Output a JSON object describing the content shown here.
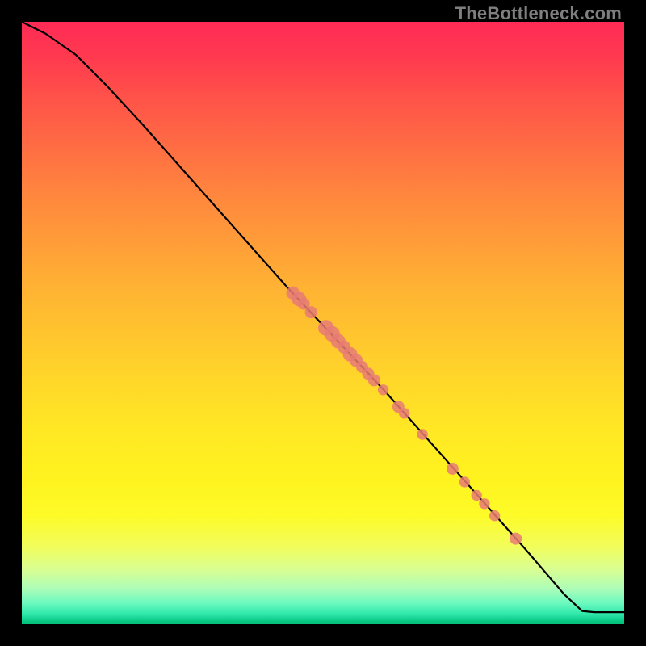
{
  "watermark": "TheBottleneck.com",
  "chart_data": {
    "type": "line",
    "title": "",
    "xlabel": "",
    "ylabel": "",
    "xlim": [
      0,
      100
    ],
    "ylim": [
      0,
      100
    ],
    "grid": false,
    "series": [
      {
        "name": "curve",
        "points": [
          {
            "x": 0,
            "y": 100
          },
          {
            "x": 4,
            "y": 98
          },
          {
            "x": 9,
            "y": 94.5
          },
          {
            "x": 14,
            "y": 89.5
          },
          {
            "x": 20,
            "y": 83
          },
          {
            "x": 28,
            "y": 74
          },
          {
            "x": 36,
            "y": 65
          },
          {
            "x": 44,
            "y": 56
          },
          {
            "x": 52,
            "y": 47.5
          },
          {
            "x": 60,
            "y": 39
          },
          {
            "x": 68,
            "y": 30
          },
          {
            "x": 76,
            "y": 21
          },
          {
            "x": 84,
            "y": 12
          },
          {
            "x": 90,
            "y": 5
          },
          {
            "x": 93,
            "y": 2.2
          },
          {
            "x": 95,
            "y": 2
          },
          {
            "x": 100,
            "y": 2
          }
        ]
      }
    ],
    "markers": [
      {
        "x": 45.0,
        "y": 55.0,
        "r": 1.1
      },
      {
        "x": 46.0,
        "y": 54.0,
        "r": 1.2
      },
      {
        "x": 46.8,
        "y": 53.2,
        "r": 1.0
      },
      {
        "x": 48.0,
        "y": 51.8,
        "r": 1.0
      },
      {
        "x": 50.5,
        "y": 49.2,
        "r": 1.3
      },
      {
        "x": 51.5,
        "y": 48.2,
        "r": 1.3
      },
      {
        "x": 52.5,
        "y": 47.0,
        "r": 1.2
      },
      {
        "x": 53.5,
        "y": 46.0,
        "r": 1.1
      },
      {
        "x": 54.5,
        "y": 44.8,
        "r": 1.2
      },
      {
        "x": 55.5,
        "y": 43.8,
        "r": 1.1
      },
      {
        "x": 56.5,
        "y": 42.7,
        "r": 1.0
      },
      {
        "x": 57.5,
        "y": 41.6,
        "r": 1.0
      },
      {
        "x": 58.5,
        "y": 40.5,
        "r": 1.0
      },
      {
        "x": 60.0,
        "y": 38.9,
        "r": 0.9
      },
      {
        "x": 62.5,
        "y": 36.1,
        "r": 1.0
      },
      {
        "x": 63.5,
        "y": 35.0,
        "r": 0.9
      },
      {
        "x": 66.5,
        "y": 31.5,
        "r": 0.9
      },
      {
        "x": 71.5,
        "y": 25.8,
        "r": 1.0
      },
      {
        "x": 73.5,
        "y": 23.6,
        "r": 0.9
      },
      {
        "x": 75.5,
        "y": 21.4,
        "r": 0.9
      },
      {
        "x": 76.8,
        "y": 20.0,
        "r": 0.9
      },
      {
        "x": 78.5,
        "y": 18.0,
        "r": 0.9
      },
      {
        "x": 82.0,
        "y": 14.2,
        "r": 1.0
      }
    ]
  },
  "colors": {
    "marker": "#e77b74",
    "curve": "#000000"
  }
}
